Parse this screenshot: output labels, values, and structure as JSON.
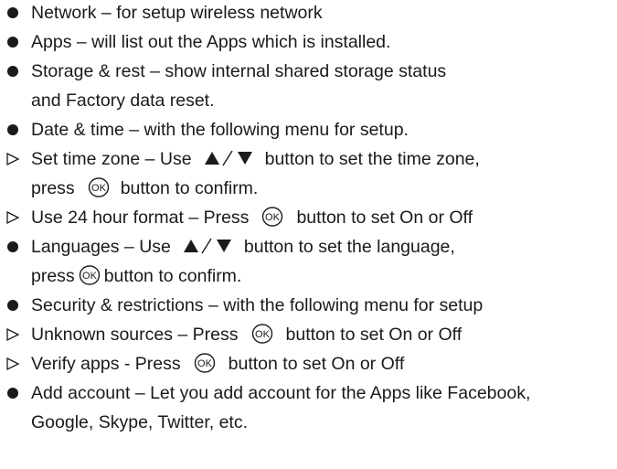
{
  "icons": {
    "bullet": "bullet-dot-icon",
    "arrow": "arrow-right-outline-icon",
    "ok_button": "ok-button-icon",
    "up_down": "up-down-triangle-icon",
    "ok_label": "OK"
  },
  "items": {
    "network": "Network – for setup wireless network",
    "apps": "Apps – will list out the Apps which is installed.",
    "storage_1": "Storage & rest – show internal shared storage status",
    "storage_2": "and Factory data reset.",
    "date_time": "Date & time – with the following menu for setup.",
    "set_time_zone_a": "Set time zone – Use",
    "set_time_zone_b": "button to set the time zone,",
    "set_time_zone_c": "press",
    "set_time_zone_d": "button to confirm.",
    "hour24_a": "Use 24 hour format – Press",
    "hour24_b": "button to set On or Off",
    "languages_a": "Languages – Use",
    "languages_b": "button to set the language,",
    "languages_c": "press",
    "languages_d": "button to confirm.",
    "security": "Security & restrictions – with the following menu for setup",
    "unknown_a": "Unknown sources – Press",
    "unknown_b": "button to set On or Off",
    "verify_a": "Verify apps - Press",
    "verify_b": "button to set On or Off",
    "add_account_1": "Add account – Let you add account for the Apps like Facebook,",
    "add_account_2": "Google, Skype, Twitter, etc."
  }
}
